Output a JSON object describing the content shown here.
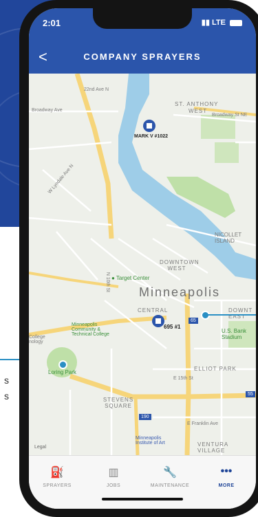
{
  "status": {
    "time": "2:01",
    "network": "LTE"
  },
  "header": {
    "title": "COMPANY SPRAYERS",
    "back": "<"
  },
  "map": {
    "city": "Minneapolis",
    "sprayers": [
      {
        "name": "MARK V #1022"
      },
      {
        "name": "695 #1"
      }
    ],
    "labels": {
      "anthony": "ST. ANTHONY",
      "west": "WEST",
      "broadway": "Broadway Ave",
      "broadway_st": "Broadway St NE",
      "nicollet": "NICOLLET ISLAND",
      "downtown_west": "DOWNTOWN WEST",
      "target_center": "Target Center",
      "central": "CENTRAL",
      "downtown_east": "DOWNT EAST",
      "us_bank": "U.S. Bank Stadium",
      "mctc": "Minneapolis Community & Technical College",
      "college_tech": "College nology",
      "loring": "Loring Park",
      "elliot": "ELLIOT PARK",
      "stevens": "STEVENS SQUARE",
      "franklin": "E Franklin Ave",
      "ventura": "VENTURA VILLAGE",
      "mia": "Minneapolis Institute of Art",
      "legal": "Legal",
      "lyndale": "W Lyndale Ave N",
      "second_ave": "22nd Ave N",
      "tenth": "N 10th St",
      "hwy_65": "65",
      "hwy_55": "55",
      "hwy_35w": "35W",
      "hwy_190": "190",
      "e15th": "E 15th St",
      "s_10th": "S 10th St"
    }
  },
  "tabs": [
    {
      "label": "SPRAYERS",
      "icon": "sprayer-icon"
    },
    {
      "label": "JOBS",
      "icon": "building-icon"
    },
    {
      "label": "MAINTENANCE",
      "icon": "wrench-icon"
    },
    {
      "label": "MORE",
      "icon": "more-icon"
    }
  ],
  "side": {
    "line1": "s",
    "line2": "s"
  },
  "colors": {
    "header": "#2b55ab",
    "accent": "#2a8fc4",
    "river": "#9ecde8",
    "park": "#bfe0a8"
  }
}
